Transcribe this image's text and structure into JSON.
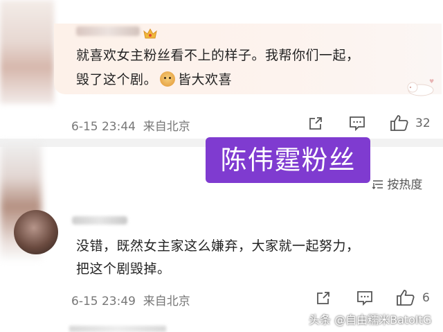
{
  "comments": [
    {
      "text_line1": "就喜欢女主粉丝看不上的样子。我帮你们一起，",
      "text_line2_a": "毁了这个剧。",
      "text_line2_b": "皆大欢喜",
      "emoji": "doge-emoji",
      "time": "6-15 23:44",
      "location": "来自北京",
      "likes": "32"
    },
    {
      "text_line1": "没错，既然女主家这么嫌弃，大家就一起努力，",
      "text_line2": "把这个剧毁掉。",
      "time": "6-15 23:49",
      "location": "来自北京",
      "likes": "6"
    }
  ],
  "overlay_tag": "陈伟霆粉丝",
  "sort_label": "按热度",
  "watermark": "头条 @自由糯米BatoItG",
  "icons": [
    "share-icon",
    "comment-icon",
    "like-icon",
    "sort-icon",
    "vip-crown-icon"
  ],
  "colors": {
    "tag_bg": "#7f3bd0",
    "bubble_bg": "#fdf1e9",
    "meta_text": "#777777"
  }
}
